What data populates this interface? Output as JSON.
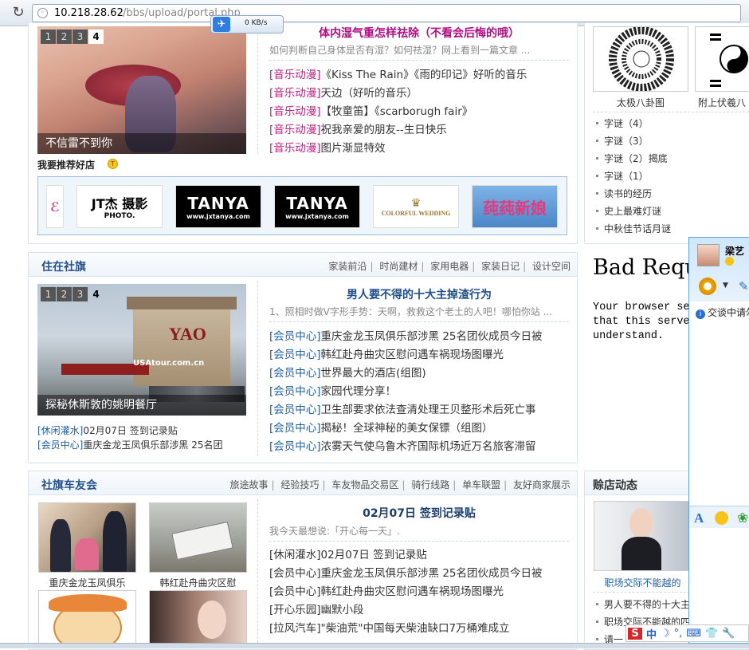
{
  "browser": {
    "url_host": "10.218.28.62",
    "url_path": "/bbs/upload/portal.php",
    "speed_text": "0 KB/s"
  },
  "top_section": {
    "slide_numbers": [
      "1",
      "2",
      "3",
      "4"
    ],
    "active_slide": "4",
    "slide_caption": "不信雷不到你",
    "headline": "体内湿气重怎样祛除（不看会后悔的哦）",
    "summary": "如何判断自己身体是否有湿？如何祛湿？网上看到一篇文章 ...",
    "news": [
      {
        "cat": "[音乐动漫]",
        "text": "《Kiss The Rain》《雨的印记》好听的音乐"
      },
      {
        "cat": "[音乐动漫]",
        "text": "天边（好听的音乐）"
      },
      {
        "cat": "[音乐动漫]",
        "text": "【牧童笛】《scarborugh fair》"
      },
      {
        "cat": "[音乐动漫]",
        "text": "祝我亲爱的朋友--生日快乐"
      },
      {
        "cat": "[音乐动漫]",
        "text": "图片渐显特效"
      }
    ],
    "shop_title": "我要推荐好店",
    "shop_logos": [
      {
        "name": "JT杰 摄影",
        "sub": "PHOTO."
      },
      {
        "name": "TANYA",
        "sub": "www.jxtanya.com"
      },
      {
        "name": "TANYA",
        "sub": "www.jxtanya.com"
      },
      {
        "name": "COLORFUL WEDDING",
        "sub": ""
      },
      {
        "name": "莼莼新娘",
        "sub": ""
      }
    ]
  },
  "right_top": {
    "gua_captions": [
      "太极八卦图",
      "附上伏羲八"
    ],
    "list": [
      "字谜（4）",
      "字谜（3）",
      "字谜（2）揭底",
      "字谜（1）",
      "读书的经历",
      "史上最难灯谜",
      "中秋佳节话月谜"
    ]
  },
  "living": {
    "title": "住在社旗",
    "links": [
      "家装前沿",
      "时尚建材",
      "家用电器",
      "家装日记",
      "设计空间"
    ],
    "slide_numbers": [
      "1",
      "2",
      "3",
      "4"
    ],
    "active_slide": "4",
    "slide_sign": "YAO",
    "slide_watermark": "USAtour.com.cn",
    "slide_caption": "探秘休斯敦的姚明餐厅",
    "under_slide": [
      {
        "cat": "[休闲灌水]",
        "text": "02月07日 签到记录贴"
      },
      {
        "cat": "[会员中心]",
        "text": "重庆金龙玉凤俱乐部涉黑 25名团"
      }
    ],
    "headline": "男人要不得的十大主掉渣行为",
    "summary": "1、照相时做V字形手势：天啊，救救这个老土的人吧！哪怕你站 ...",
    "news": [
      {
        "cat": "[会员中心]",
        "text": "重庆金龙玉凤俱乐部涉黑 25名团伙成员今日被"
      },
      {
        "cat": "[会员中心]",
        "text": "韩红赴舟曲灾区慰问遇车祸现场图曝光"
      },
      {
        "cat": "[会员中心]",
        "text": "世界最大的酒店(组图)"
      },
      {
        "cat": "[会员中心]",
        "text": "家园代理分享！"
      },
      {
        "cat": "[会员中心]",
        "text": "卫生部要求依法查清处理王贝整形术后死亡事"
      },
      {
        "cat": "[会员中心]",
        "text": "揭秘！全球神秘的美女保镖（组图）"
      },
      {
        "cat": "[会员中心]",
        "text": "浓雾天气使乌鲁木齐国际机场近万名旅客滞留"
      }
    ]
  },
  "bad_request": {
    "title": "Bad Request",
    "body": "Your browser sent a request\nthat this server could not\nunderstand."
  },
  "bikes": {
    "title": "社旗车友会",
    "links": [
      "旅途故事",
      "经验技巧",
      "车友物品交易区",
      "骑行线路",
      "单车联盟",
      "友好商家展示"
    ],
    "thumb_captions": [
      "重庆金龙玉凤俱乐",
      "韩红赴舟曲灾区慰"
    ],
    "headline": "02月07日 签到记录贴",
    "summary": "我今天最想说:「开心每一天」.",
    "news": [
      {
        "cat": "[休闲灌水]",
        "text": "02月07日 签到记录贴"
      },
      {
        "cat": "[会员中心]",
        "text": "重庆金龙玉凤俱乐部涉黑 25名团伙成员今日被"
      },
      {
        "cat": "[会员中心]",
        "text": "韩红赴舟曲灾区慰问遇车祸现场图曝光"
      },
      {
        "cat": "[开心乐园]",
        "text": "幽默小段"
      },
      {
        "cat": "[拉风汽车]",
        "text": "\"柴油荒\"中国每天柴油缺口7万桶难成立"
      }
    ]
  },
  "shop_news": {
    "title": "赊店动态",
    "image_caption": "职场交际不能越的",
    "list": [
      "男人要不得的十大主",
      "职场交际不能越的四",
      "请一"
    ]
  },
  "chat": {
    "name": "梁艺",
    "notice": "交谈中请勿"
  },
  "ime": {
    "items": [
      "S",
      "中",
      "☽",
      "°,",
      "⌨",
      "👕",
      "🔧"
    ]
  },
  "colors": {
    "accent": "#24528c",
    "pink_category": "#c41b85",
    "blue_category": "#1b5fa8"
  }
}
